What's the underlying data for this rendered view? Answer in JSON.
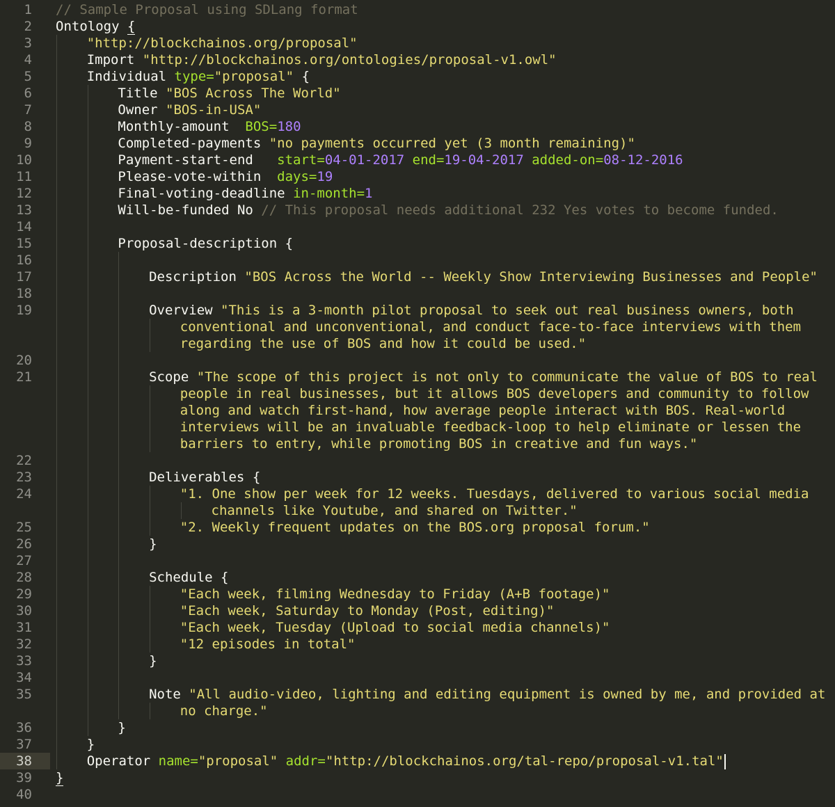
{
  "lines": [
    {
      "n": "1",
      "i": 0,
      "t": [
        [
          "c",
          "// Sample Proposal using SDLang format"
        ]
      ]
    },
    {
      "n": "2",
      "i": 0,
      "t": [
        [
          "k",
          "Ontology "
        ],
        [
          "bu",
          "{"
        ]
      ]
    },
    {
      "n": "3",
      "i": 1,
      "t": [
        [
          "s",
          "\"http://blockchainos.org/proposal\""
        ]
      ]
    },
    {
      "n": "4",
      "i": 1,
      "t": [
        [
          "k",
          "Import "
        ],
        [
          "s",
          "\"http://blockchainos.org/ontologies/proposal-v1.owl\""
        ]
      ]
    },
    {
      "n": "5",
      "i": 1,
      "t": [
        [
          "k",
          "Individual "
        ],
        [
          "a",
          "type="
        ],
        [
          "s",
          "\"proposal\""
        ],
        [
          "p",
          " {"
        ]
      ]
    },
    {
      "n": "6",
      "i": 2,
      "t": [
        [
          "k",
          "Title "
        ],
        [
          "s",
          "\"BOS Across The World\""
        ]
      ]
    },
    {
      "n": "7",
      "i": 2,
      "t": [
        [
          "k",
          "Owner "
        ],
        [
          "s",
          "\"BOS-in-USA\""
        ]
      ]
    },
    {
      "n": "8",
      "i": 2,
      "t": [
        [
          "k",
          "Monthly-amount  "
        ],
        [
          "a",
          "BOS="
        ],
        [
          "n",
          "180"
        ]
      ]
    },
    {
      "n": "9",
      "i": 2,
      "t": [
        [
          "k",
          "Completed-payments "
        ],
        [
          "s",
          "\"no payments occurred yet (3 month remaining)\""
        ]
      ]
    },
    {
      "n": "10",
      "i": 2,
      "t": [
        [
          "k",
          "Payment-start-end   "
        ],
        [
          "a",
          "start="
        ],
        [
          "n",
          "04-01-2017"
        ],
        [
          "a",
          " end="
        ],
        [
          "n",
          "19-04-2017"
        ],
        [
          "a",
          " added-on="
        ],
        [
          "n",
          "08-12-2016"
        ]
      ]
    },
    {
      "n": "11",
      "i": 2,
      "t": [
        [
          "k",
          "Please-vote-within  "
        ],
        [
          "a",
          "days="
        ],
        [
          "n",
          "19"
        ]
      ]
    },
    {
      "n": "12",
      "i": 2,
      "t": [
        [
          "k",
          "Final-voting-deadline "
        ],
        [
          "a",
          "in-month="
        ],
        [
          "n",
          "1"
        ]
      ]
    },
    {
      "n": "13",
      "i": 2,
      "t": [
        [
          "k",
          "Will-be-funded No "
        ],
        [
          "c",
          "// This proposal needs additional 232 Yes votes to become funded."
        ]
      ]
    },
    {
      "n": "14",
      "i": 2,
      "t": []
    },
    {
      "n": "15",
      "i": 2,
      "t": [
        [
          "k",
          "Proposal-description "
        ],
        [
          "p",
          "{"
        ]
      ]
    },
    {
      "n": "16",
      "i": 3,
      "t": []
    },
    {
      "n": "17",
      "i": 3,
      "t": [
        [
          "k",
          "Description "
        ],
        [
          "s",
          "\"BOS Across the World -- Weekly Show Interviewing Businesses and People\""
        ]
      ]
    },
    {
      "n": "18",
      "i": 3,
      "t": []
    },
    {
      "n": "19",
      "i": 3,
      "t": [
        [
          "k",
          "Overview "
        ],
        [
          "s",
          "\"This is a 3-month pilot proposal to seek out real business owners, both"
        ]
      ]
    },
    {
      "n": "",
      "i": 4,
      "t": [
        [
          "s",
          "conventional and unconventional, and conduct face-to-face interviews with them"
        ]
      ]
    },
    {
      "n": "",
      "i": 4,
      "t": [
        [
          "s",
          "regarding the use of BOS and how it could be used.\""
        ]
      ]
    },
    {
      "n": "20",
      "i": 3,
      "t": []
    },
    {
      "n": "21",
      "i": 3,
      "t": [
        [
          "k",
          "Scope "
        ],
        [
          "s",
          "\"The scope of this project is not only to communicate the value of BOS to real"
        ]
      ]
    },
    {
      "n": "",
      "i": 4,
      "t": [
        [
          "s",
          "people in real businesses, but it allows BOS developers and community to follow"
        ]
      ]
    },
    {
      "n": "",
      "i": 4,
      "t": [
        [
          "s",
          "along and watch first-hand, how average people interact with BOS. Real-world"
        ]
      ]
    },
    {
      "n": "",
      "i": 4,
      "t": [
        [
          "s",
          "interviews will be an invaluable feedback-loop to help eliminate or lessen the"
        ]
      ]
    },
    {
      "n": "",
      "i": 4,
      "t": [
        [
          "s",
          "barriers to entry, while promoting BOS in creative and fun ways.\""
        ]
      ]
    },
    {
      "n": "22",
      "i": 3,
      "t": []
    },
    {
      "n": "23",
      "i": 3,
      "t": [
        [
          "k",
          "Deliverables "
        ],
        [
          "p",
          "{"
        ]
      ]
    },
    {
      "n": "24",
      "i": 4,
      "t": [
        [
          "s",
          "\"1. One show per week for 12 weeks. Tuesdays, delivered to various social media"
        ]
      ]
    },
    {
      "n": "",
      "i": 5,
      "t": [
        [
          "s",
          "channels like Youtube, and shared on Twitter.\""
        ]
      ]
    },
    {
      "n": "25",
      "i": 4,
      "t": [
        [
          "s",
          "\"2. Weekly frequent updates on the BOS.org proposal forum.\""
        ]
      ]
    },
    {
      "n": "26",
      "i": 3,
      "t": [
        [
          "p",
          "}"
        ]
      ]
    },
    {
      "n": "27",
      "i": 3,
      "t": []
    },
    {
      "n": "28",
      "i": 3,
      "t": [
        [
          "k",
          "Schedule "
        ],
        [
          "p",
          "{"
        ]
      ]
    },
    {
      "n": "29",
      "i": 4,
      "t": [
        [
          "s",
          "\"Each week, filming Wednesday to Friday (A+B footage)\""
        ]
      ]
    },
    {
      "n": "30",
      "i": 4,
      "t": [
        [
          "s",
          "\"Each week, Saturday to Monday (Post, editing)\""
        ]
      ]
    },
    {
      "n": "31",
      "i": 4,
      "t": [
        [
          "s",
          "\"Each week, Tuesday (Upload to social media channels)\""
        ]
      ]
    },
    {
      "n": "32",
      "i": 4,
      "t": [
        [
          "s",
          "\"12 episodes in total\""
        ]
      ]
    },
    {
      "n": "33",
      "i": 3,
      "t": [
        [
          "p",
          "}"
        ]
      ]
    },
    {
      "n": "34",
      "i": 3,
      "t": []
    },
    {
      "n": "35",
      "i": 3,
      "t": [
        [
          "k",
          "Note "
        ],
        [
          "s",
          "\"All audio-video, lighting and editing equipment is owned by me, and provided at"
        ]
      ]
    },
    {
      "n": "",
      "i": 4,
      "t": [
        [
          "s",
          "no charge.\""
        ]
      ]
    },
    {
      "n": "36",
      "i": 2,
      "t": [
        [
          "p",
          "}"
        ]
      ]
    },
    {
      "n": "37",
      "i": 1,
      "t": [
        [
          "p",
          "}"
        ]
      ]
    },
    {
      "n": "38",
      "i": 1,
      "active": true,
      "t": [
        [
          "k",
          "Operator "
        ],
        [
          "a",
          "name="
        ],
        [
          "s",
          "\"proposal\""
        ],
        [
          "a",
          " addr="
        ],
        [
          "s",
          "\"http://blockchainos.org/tal-repo/proposal-v1.tal\""
        ],
        [
          "caret",
          ""
        ]
      ]
    },
    {
      "n": "39",
      "i": 0,
      "t": [
        [
          "bu",
          "}"
        ]
      ]
    },
    {
      "n": "40",
      "i": 0,
      "t": []
    }
  ]
}
